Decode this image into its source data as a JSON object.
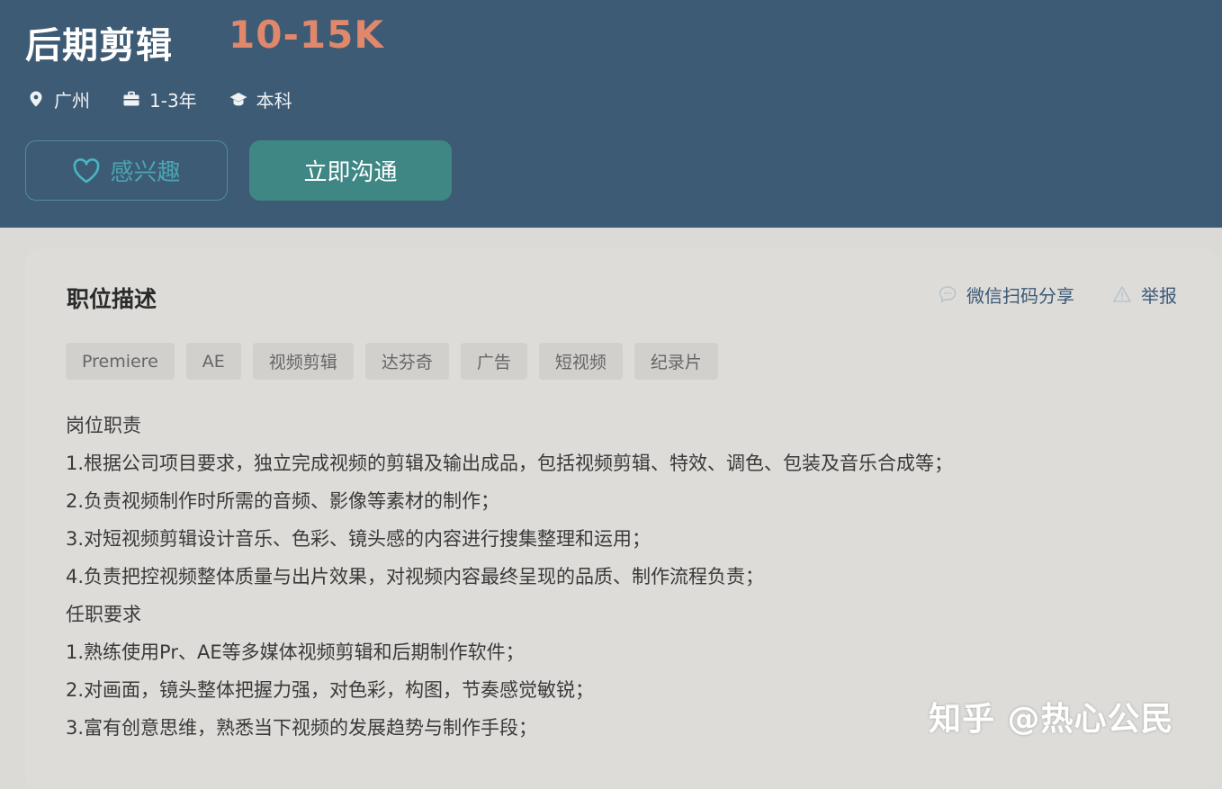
{
  "job": {
    "title": "后期剪辑",
    "salary": "10-15K",
    "location": "广州",
    "experience": "1-3年",
    "education": "本科"
  },
  "buttons": {
    "interest_label": "感兴趣",
    "chat_label": "立即沟通"
  },
  "description": {
    "title": "职位描述",
    "share_label": "微信扫码分享",
    "report_label": "举报",
    "tags": [
      "Premiere",
      "AE",
      "视频剪辑",
      "达芬奇",
      "广告",
      "短视频",
      "纪录片"
    ],
    "lines": [
      "岗位职责",
      "1.根据公司项目要求，独立完成视频的剪辑及输出成品，包括视频剪辑、特效、调色、包装及音乐合成等；",
      "2.负责视频制作时所需的音频、影像等素材的制作；",
      "3.对短视频剪辑设计音乐、色彩、镜头感的内容进行搜集整理和运用；",
      "4.负责把控视频整体质量与出片效果，对视频内容最终呈现的品质、制作流程负责；",
      "任职要求",
      "1.熟练使用Pr、AE等多媒体视频剪辑和后期制作软件；",
      "2.对画面，镜头整体把握力强，对色彩，构图，节奏感觉敏锐；",
      "3.富有创意思维，熟悉当下视频的发展趋势与制作手段；"
    ]
  },
  "watermark": "知乎 @热心公民",
  "icons": {
    "location": "location-pin-icon",
    "experience": "briefcase-icon",
    "education": "graduation-cap-icon",
    "interest": "heart-icon",
    "share": "chat-bubble-icon",
    "report": "warning-icon"
  },
  "colors": {
    "header_bg": "#3d5b74",
    "salary": "#e0876c",
    "interest": "#49a5b3",
    "chat_button": "#3f8784",
    "page_bg": "#dcdad6"
  }
}
